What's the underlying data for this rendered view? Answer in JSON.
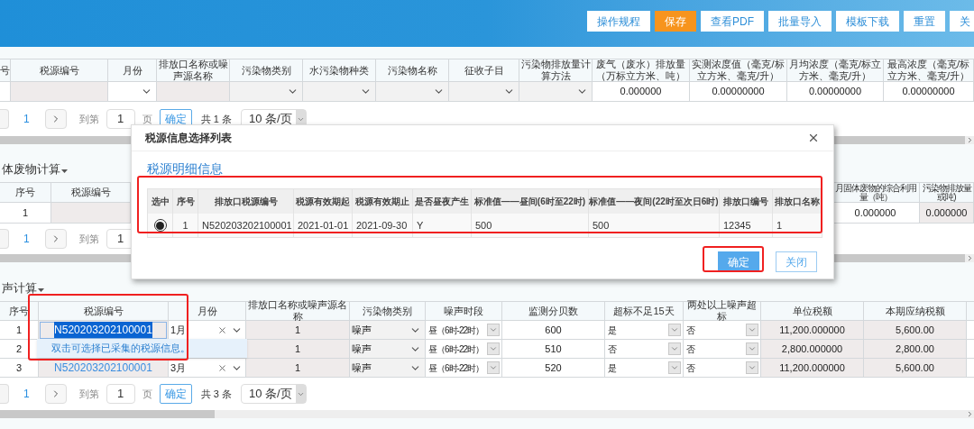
{
  "toolbar": {
    "buttons": [
      {
        "label": "操作规程",
        "kind": "default"
      },
      {
        "label": "保存",
        "kind": "primary"
      },
      {
        "label": "查看PDF",
        "kind": "default"
      },
      {
        "label": "批量导入",
        "kind": "default"
      },
      {
        "label": "模板下载",
        "kind": "default"
      },
      {
        "label": "重置",
        "kind": "default"
      },
      {
        "label": "关",
        "kind": "default"
      }
    ]
  },
  "water_section": {
    "table": {
      "columns": [
        "号",
        "税源编号",
        "月份",
        "排放口名称或噪声源名称",
        "污染物类别",
        "水污染物种类",
        "污染物名称",
        "征收子目",
        "污染物排放量计算方法",
        "废气（废水）排放量（万标立方米、吨）",
        "实测浓度值（毫克/标立方米、毫克/升）",
        "月均浓度（毫克/标立方米、毫克/升）",
        "最高浓度（毫克/标立方米、毫克/升）"
      ],
      "rows": [
        {
          "cells": [
            {
              "kind": "blank"
            },
            {
              "kind": "readonly"
            },
            {
              "kind": "select",
              "disabled": false
            },
            {
              "kind": "readonly"
            },
            {
              "kind": "select",
              "disabled": true
            },
            {
              "kind": "select",
              "disabled": true
            },
            {
              "kind": "select",
              "disabled": true
            },
            {
              "kind": "select",
              "disabled": true
            },
            {
              "kind": "select",
              "disabled": true
            },
            {
              "kind": "value",
              "text": "0.000000"
            },
            {
              "kind": "value",
              "text": "0.00000000"
            },
            {
              "kind": "value",
              "text": "0.00000000"
            },
            {
              "kind": "value",
              "text": "0.00000000"
            }
          ]
        }
      ]
    },
    "pagination": {
      "page": "1",
      "goto": "到第",
      "input": "1",
      "unit": "页",
      "confirm": "确定",
      "total": "共 1 条",
      "page_size": "10 条/页"
    }
  },
  "solid_section": {
    "title": "体废物计算",
    "table": {
      "columns_left": [
        "序号",
        "税源编号"
      ],
      "columns_right": [
        {
          "lines": [
            "月固体废物的综合利用",
            "量（吨）"
          ]
        },
        {
          "lines": [
            "污染物排放量",
            "或吨)"
          ]
        }
      ],
      "rows": [
        {
          "cells_left": [
            {
              "kind": "value",
              "text": "1"
            },
            {
              "kind": "readonly"
            }
          ],
          "cells_right": [
            {
              "kind": "value",
              "text": "0.000000"
            },
            {
              "kind": "readonly",
              "text": "0.000000"
            }
          ]
        }
      ]
    },
    "pagination": {
      "page": "1",
      "goto": "到第",
      "input": "1"
    }
  },
  "noise_section": {
    "title": "声计算",
    "table": {
      "columns": [
        "序号",
        "税源编号",
        "月份",
        "排放口名称或噪声源名称",
        "污染物类别",
        "噪声时段",
        "监测分贝数",
        "超标不足15天",
        "两处以上噪声超标",
        "单位税额",
        "本期应纳税额"
      ],
      "rows": [
        {
          "cells": [
            {
              "kind": "value",
              "text": "1"
            },
            {
              "kind": "source",
              "text": "N520203202100001",
              "selected": true
            },
            {
              "kind": "month",
              "text": "1月"
            },
            {
              "kind": "readonly",
              "text": "1"
            },
            {
              "kind": "select",
              "disabled": true,
              "text": "噪声"
            },
            {
              "kind": "dropdown",
              "text": "昼（6时-22时）"
            },
            {
              "kind": "value",
              "text": "600"
            },
            {
              "kind": "dropdown",
              "text": "是"
            },
            {
              "kind": "dropdown",
              "text": "否"
            },
            {
              "kind": "readonly",
              "text": "11,200.000000"
            },
            {
              "kind": "readonly",
              "text": "5,600.00"
            }
          ]
        },
        {
          "cells": [
            {
              "kind": "value",
              "text": "2"
            },
            {
              "kind": "covered"
            },
            {
              "kind": "covered"
            },
            {
              "kind": "readonly",
              "text": "1"
            },
            {
              "kind": "select",
              "disabled": true,
              "text": "噪声"
            },
            {
              "kind": "dropdown",
              "text": "昼（6时-22时）"
            },
            {
              "kind": "value",
              "text": "510"
            },
            {
              "kind": "dropdown",
              "text": "否"
            },
            {
              "kind": "dropdown",
              "text": "否"
            },
            {
              "kind": "readonly",
              "text": "2,800.000000"
            },
            {
              "kind": "readonly",
              "text": "2,800.00"
            }
          ]
        },
        {
          "cells": [
            {
              "kind": "value",
              "text": "3"
            },
            {
              "kind": "source",
              "text": "N520203202100001",
              "selected": false
            },
            {
              "kind": "month",
              "text": "3月"
            },
            {
              "kind": "readonly",
              "text": "1"
            },
            {
              "kind": "select",
              "disabled": true,
              "text": "噪声"
            },
            {
              "kind": "dropdown",
              "text": "昼（6时-22时）"
            },
            {
              "kind": "value",
              "text": "520"
            },
            {
              "kind": "dropdown",
              "text": "是"
            },
            {
              "kind": "dropdown",
              "text": "否"
            },
            {
              "kind": "readonly",
              "text": "11,200.000000"
            },
            {
              "kind": "readonly",
              "text": "5,600.00"
            }
          ]
        }
      ]
    },
    "tooltip": "双击可选择已采集的税源信息。",
    "pagination": {
      "page": "1",
      "goto": "到第",
      "input": "1",
      "unit": "页",
      "confirm": "确定",
      "total": "共 3 条",
      "page_size": "10 条/页"
    }
  },
  "dialog": {
    "title": "税源信息选择列表",
    "heading": "税源明细信息",
    "columns": [
      "选中",
      "序号",
      "排放口税源编号",
      "税源有效期起",
      "税源有效期止",
      "是否昼夜产生",
      "标准值——昼间(6时至22时)",
      "标准值——夜间(22时至次日6时)",
      "排放口编号",
      "排放口名称"
    ],
    "rows": [
      {
        "selected": true,
        "cells": [
          "",
          "1",
          "N520203202100001",
          "2021-01-01",
          "2021-09-30",
          "Y",
          "500",
          "500",
          "12345",
          "1"
        ]
      }
    ],
    "buttons": [
      {
        "label": "确定",
        "kind": "primary"
      },
      {
        "label": "关闭",
        "kind": "default"
      }
    ]
  }
}
